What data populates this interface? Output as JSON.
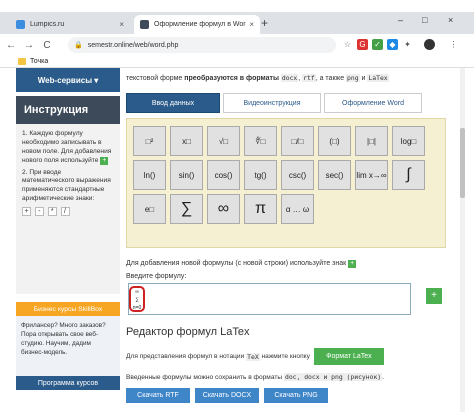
{
  "browser": {
    "tabs": [
      {
        "title": "Lumpics.ru",
        "favicon_color": "#3b8de0"
      },
      {
        "title": "Оформление формул в Word онл",
        "favicon_color": "#3d4a5a"
      }
    ],
    "close_symbol": "×",
    "new_tab_symbol": "+",
    "window_controls": [
      "–",
      "□",
      "×"
    ],
    "nav": {
      "back": "←",
      "forward": "→",
      "reload": "C"
    },
    "url": "semestr.online/web/word.php",
    "lock_symbol": "🔒",
    "toolbar_icons": [
      "star-icon",
      "extension-red-icon",
      "check-green-icon",
      "shield-blue-icon",
      "puzzle-icon",
      "avatar",
      "menu-icon"
    ],
    "bookmark": {
      "label": "Точка",
      "color": "#f4c542"
    }
  },
  "sidebar": {
    "header": "Web-сервисы ▾",
    "title": "Инструкция",
    "step1": "1. Каждую формулу необходимо записывать в новом поле. Для добавления нового поля используйте",
    "step2": "2. При вводе математического выражения применяются стандартные арифметические знаки:",
    "operators": [
      "+",
      "-",
      "*",
      "/"
    ],
    "ad_title": "Бизнес курсы SkillBox",
    "ad_text": "Фрилансер? Много заказов? Пора открывать свое веб-студию. Научим, дадим бизнес-модель.",
    "ad_button": "Программа курсов"
  },
  "main": {
    "intro": {
      "prefix": "текстовой форме ",
      "bold": "преобразуются в форматы ",
      "code1": "docx",
      "sep1": ", ",
      "code2": "rtf",
      "mid": ", а также ",
      "code3": "png",
      "and": " и ",
      "code4": "LaTex"
    },
    "tabs": [
      "Ввод данных",
      "Видеоинструкция",
      "Оформление Word"
    ],
    "symbols": [
      [
        "□²",
        "x□",
        "√□",
        "∜□",
        "□/□",
        "(□)",
        "|□|",
        "log□"
      ],
      [
        "ln()",
        "sin()",
        "cos()",
        "tg()",
        "csc()",
        "sec()",
        "lim x→∞",
        "∫"
      ],
      [
        "e□",
        "∑",
        "∞",
        "π",
        "α … ω",
        "",
        "",
        ""
      ]
    ],
    "new_line_hint": "Для добавления новой формулы (с новой строки) используйте знак",
    "input_label": "Введите формулу:",
    "input_value": "",
    "sum_icon_text": "∞\n∑\nn=0",
    "add_button": "+",
    "latex_section": {
      "title": "Редактор формул LaTex",
      "text_before": "Для представления формул в нотации",
      "code": "TeX",
      "text_after": "нажмите кнопку",
      "button": "Формат LaTex"
    },
    "save_text": {
      "before": "Введенные формулы можно сохранить в форматы",
      "formats": "doc, docx и png (рисунок)",
      "after": "."
    },
    "save_buttons": [
      "Скачать RTF",
      "Скачать DOCX",
      "Скачать PNG"
    ]
  },
  "colors": {
    "accent_blue": "#2b5b8a",
    "green": "#4caf50",
    "editor_bg": "#f6f0d3",
    "orange": "#f6a623"
  }
}
